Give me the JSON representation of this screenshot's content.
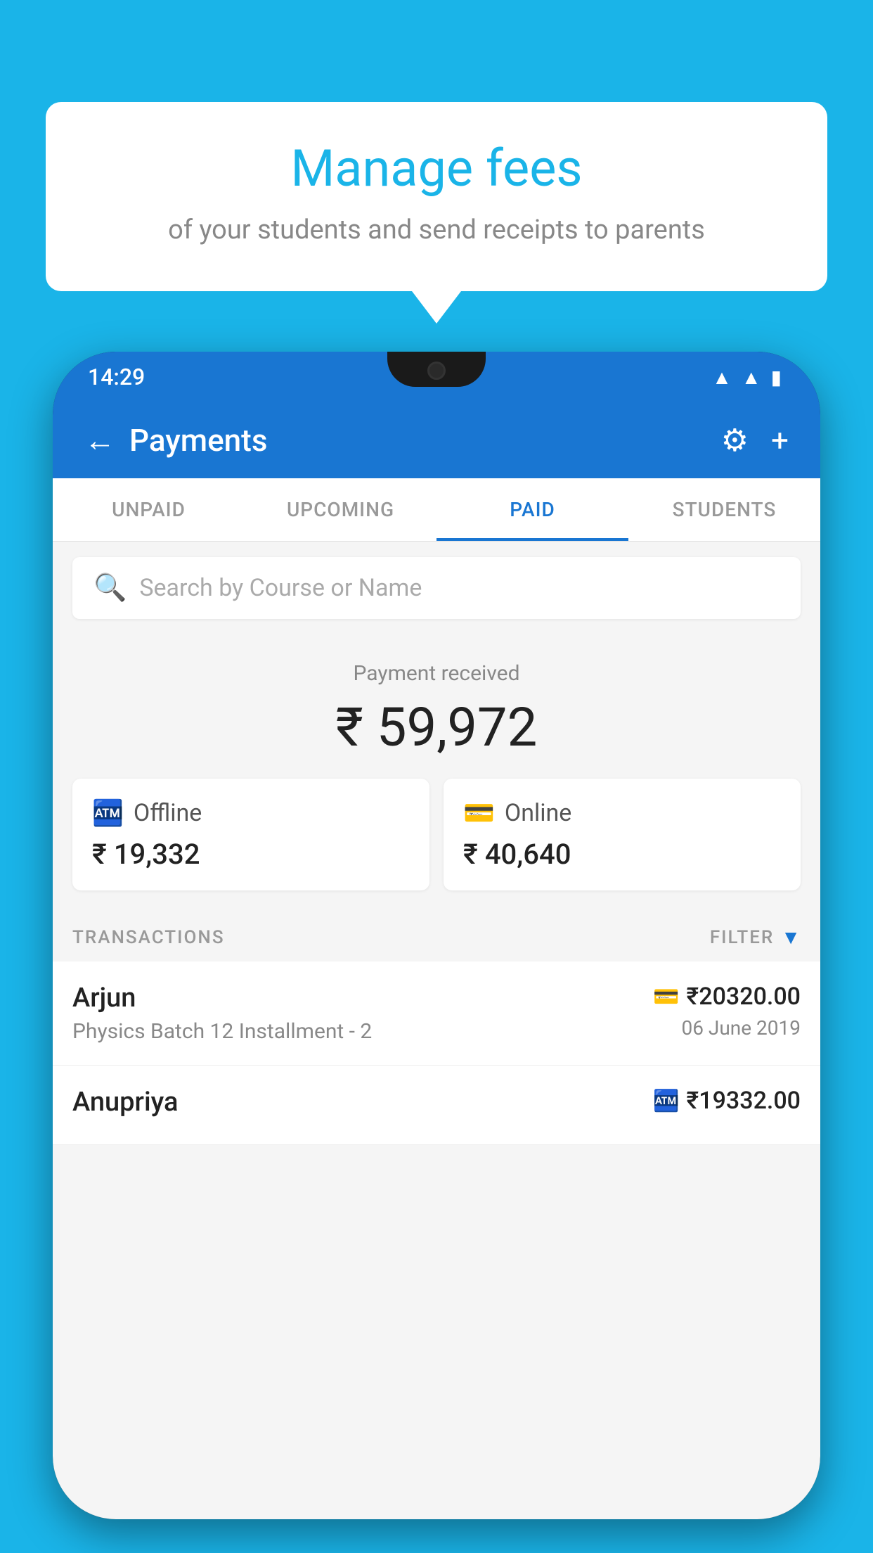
{
  "background_color": "#1ab4e8",
  "speech_bubble": {
    "title": "Manage fees",
    "subtitle": "of your students and send receipts to parents"
  },
  "phone": {
    "status_bar": {
      "time": "14:29",
      "icons": [
        "wifi",
        "signal",
        "battery"
      ]
    },
    "header": {
      "title": "Payments",
      "back_label": "←",
      "settings_label": "⚙",
      "add_label": "+"
    },
    "tabs": [
      {
        "label": "UNPAID",
        "active": false
      },
      {
        "label": "UPCOMING",
        "active": false
      },
      {
        "label": "PAID",
        "active": true
      },
      {
        "label": "STUDENTS",
        "active": false
      }
    ],
    "search": {
      "placeholder": "Search by Course or Name"
    },
    "payment_summary": {
      "label": "Payment received",
      "amount": "₹ 59,972",
      "offline_label": "Offline",
      "offline_amount": "₹ 19,332",
      "online_label": "Online",
      "online_amount": "₹ 40,640"
    },
    "transactions_section": {
      "label": "TRANSACTIONS",
      "filter_label": "FILTER"
    },
    "transactions": [
      {
        "name": "Arjun",
        "description": "Physics Batch 12 Installment - 2",
        "amount": "₹20320.00",
        "date": "06 June 2019",
        "method": "card"
      },
      {
        "name": "Anupriya",
        "description": "",
        "amount": "₹19332.00",
        "date": "",
        "method": "cash"
      }
    ]
  }
}
